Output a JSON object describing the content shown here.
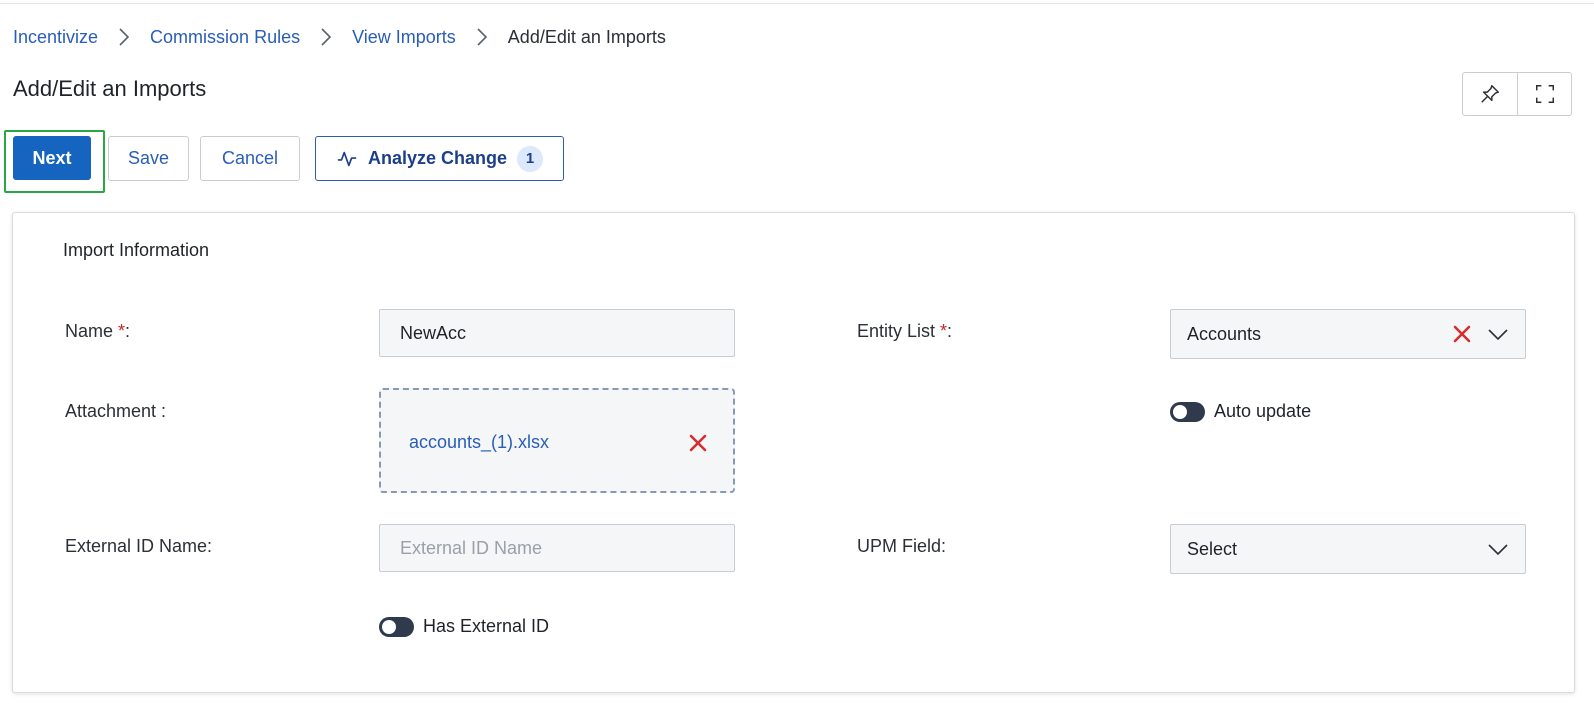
{
  "breadcrumb": {
    "items": [
      "Incentivize",
      "Commission Rules",
      "View Imports"
    ],
    "current": "Add/Edit an Imports"
  },
  "page": {
    "title": "Add/Edit an Imports"
  },
  "toolbar": {
    "next_label": "Next",
    "save_label": "Save",
    "cancel_label": "Cancel",
    "analyze_label": "Analyze Change",
    "analyze_count": "1"
  },
  "header_icons": [
    "pin-icon",
    "fullscreen-icon"
  ],
  "form": {
    "section_title": "Import Information",
    "name": {
      "label": "Name ",
      "required_mark": "*",
      "suffix": ":",
      "value": "NewAcc"
    },
    "entity_list": {
      "label": "Entity List ",
      "required_mark": "*",
      "suffix": ":",
      "value": "Accounts"
    },
    "attachment": {
      "label": "Attachment :",
      "file_name": "accounts_(1).xlsx"
    },
    "auto_update": {
      "label": "Auto update",
      "enabled": false
    },
    "external_id_name": {
      "label": "External ID Name:",
      "value": "",
      "placeholder": "External ID Name"
    },
    "upm_field": {
      "label": "UPM Field:",
      "value": "Select"
    },
    "has_external_id": {
      "label": "Has External ID",
      "enabled": false
    }
  },
  "colors": {
    "primary": "#1565c0",
    "link": "#2a5db8",
    "focus_outline": "#27a844",
    "danger": "#d32f2f",
    "toggle_off": "#2f3b4d"
  }
}
